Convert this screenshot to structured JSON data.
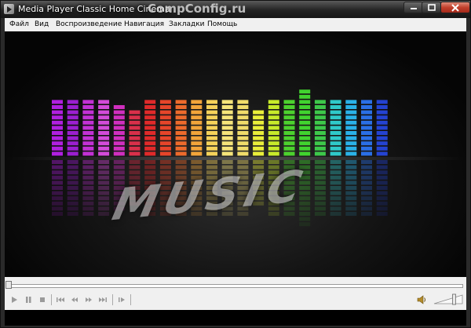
{
  "window": {
    "title": "Media Player Classic Home Cinema",
    "watermark": "CompConfig.ru"
  },
  "menu": [
    {
      "label": "Файл"
    },
    {
      "label": "Вид"
    },
    {
      "label": "Воспроизведение"
    },
    {
      "label": "Навигация"
    },
    {
      "label": "Закладки"
    },
    {
      "label": "Помощь"
    }
  ],
  "video": {
    "overlay_text": "MUSIC",
    "equalizer": {
      "levels_of_20": [
        11,
        11,
        11,
        11,
        10,
        9,
        11,
        11,
        11,
        11,
        11,
        11,
        11,
        9,
        11,
        11,
        13,
        11,
        11,
        11,
        11,
        11
      ],
      "colors": [
        "#b01fe0",
        "#9b1fd0",
        "#c231d5",
        "#d34bd9",
        "#d02fbf",
        "#d9304a",
        "#e02a2a",
        "#e6452a",
        "#ed6a2c",
        "#f2a53a",
        "#f6d25a",
        "#f5e47a",
        "#f0dc6a",
        "#e9ee3a",
        "#c7ea2a",
        "#4cd12e",
        "#41d32f",
        "#3dc84a",
        "#2fc9c9",
        "#2ab2e8",
        "#2a6fe6",
        "#2443d2"
      ]
    },
    "colors": {
      "top_left_bar": "#b01fe0"
    }
  },
  "controls": {
    "seek_position": 0.0,
    "volume": 0.75,
    "buttons": [
      {
        "name": "play-button",
        "icon": "play-icon"
      },
      {
        "name": "pause-button",
        "icon": "pause-icon"
      },
      {
        "name": "stop-button",
        "icon": "stop-icon"
      },
      {
        "name": "previous-button",
        "icon": "skip-back-icon"
      },
      {
        "name": "rewind-button",
        "icon": "rewind-icon"
      },
      {
        "name": "fast-forward-button",
        "icon": "fast-forward-icon"
      },
      {
        "name": "next-button",
        "icon": "skip-forward-icon"
      },
      {
        "name": "frame-step-button",
        "icon": "frame-step-icon"
      }
    ]
  }
}
